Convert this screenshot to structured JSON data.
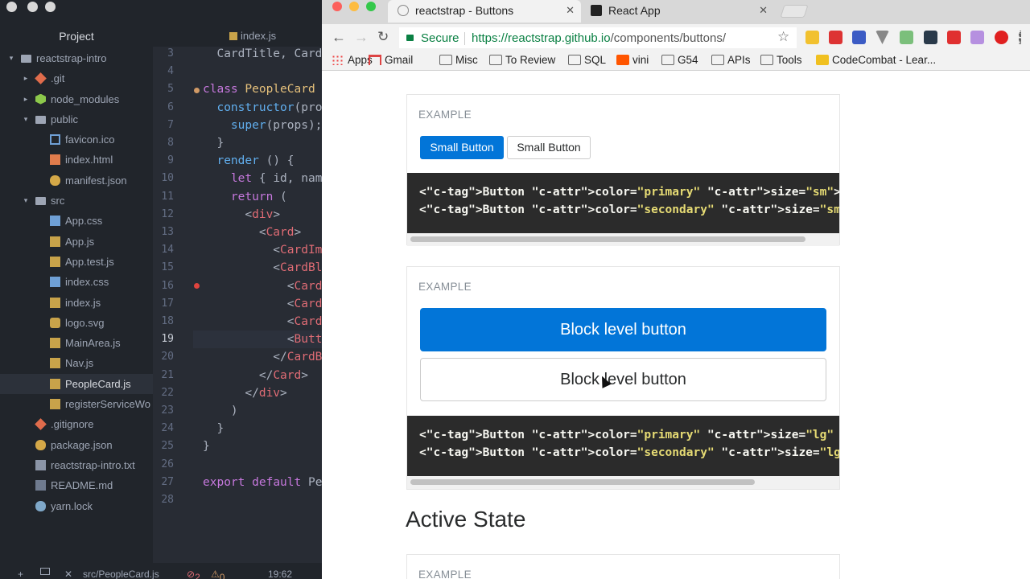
{
  "atom": {
    "tree_header": "Project",
    "tab_title": "index.js",
    "tree": [
      {
        "label": "reactstrap-intro",
        "icon": "folder-icon",
        "indent": 0,
        "arrow": "▾"
      },
      {
        "label": ".git",
        "icon": "git-icon",
        "indent": 1,
        "arrow": "▸"
      },
      {
        "label": "node_modules",
        "icon": "node-icon",
        "indent": 1,
        "arrow": "▸"
      },
      {
        "label": "public",
        "icon": "folder-icon",
        "indent": 1,
        "arrow": "▾"
      },
      {
        "label": "favicon.ico",
        "icon": "image-icon",
        "indent": 2
      },
      {
        "label": "index.html",
        "icon": "html-icon",
        "indent": 2
      },
      {
        "label": "manifest.json",
        "icon": "json-icon",
        "indent": 2
      },
      {
        "label": "src",
        "icon": "folder-icon",
        "indent": 1,
        "arrow": "▾"
      },
      {
        "label": "App.css",
        "icon": "css-icon",
        "indent": 2
      },
      {
        "label": "App.js",
        "icon": "js-icon",
        "indent": 2
      },
      {
        "label": "App.test.js",
        "icon": "js-icon",
        "indent": 2
      },
      {
        "label": "index.css",
        "icon": "css-icon",
        "indent": 2
      },
      {
        "label": "index.js",
        "icon": "js-icon",
        "indent": 2
      },
      {
        "label": "logo.svg",
        "icon": "svg-icon",
        "indent": 2
      },
      {
        "label": "MainArea.js",
        "icon": "js-icon",
        "indent": 2
      },
      {
        "label": "Nav.js",
        "icon": "js-icon",
        "indent": 2
      },
      {
        "label": "PeopleCard.js",
        "icon": "js-icon",
        "indent": 2,
        "selected": true
      },
      {
        "label": "registerServiceWo",
        "icon": "js-icon",
        "indent": 2
      },
      {
        "label": ".gitignore",
        "icon": "git-icon",
        "indent": 1
      },
      {
        "label": "package.json",
        "icon": "json-icon",
        "indent": 1
      },
      {
        "label": "reactstrap-intro.txt",
        "icon": "txt-icon",
        "indent": 1
      },
      {
        "label": "README.md",
        "icon": "md-icon",
        "indent": 1
      },
      {
        "label": "yarn.lock",
        "icon": "yarn-icon",
        "indent": 1
      }
    ],
    "line_numbers": [
      "3",
      "4",
      "5",
      "6",
      "7",
      "8",
      "9",
      "10",
      "11",
      "12",
      "13",
      "14",
      "15",
      "16",
      "17",
      "18",
      "19",
      "20",
      "21",
      "22",
      "23",
      "24",
      "25",
      "26",
      "27",
      "28"
    ],
    "current_line": "19",
    "code_lines": [
      "  CardTitle, Card",
      "",
      "class PeopleCard ",
      "  constructor(pro",
      "    super(props);",
      "  }",
      "  render () {",
      "    let { id, nam",
      "    return (",
      "      <div>",
      "        <Card>",
      "          <CardIm",
      "          <CardBl",
      "            <Card",
      "            <Card",
      "            <Card",
      "            <Butt",
      "          </CardB",
      "        </Card>",
      "      </div>",
      "    )",
      "  }",
      "}",
      "",
      "export default Pe",
      ""
    ],
    "status": {
      "file": "src/PeopleCard.js",
      "errors": "2",
      "warnings": "0",
      "position": "19:62"
    }
  },
  "browser": {
    "tabs": [
      {
        "title": "reactstrap - Buttons",
        "active": true
      },
      {
        "title": "React App",
        "active": false
      }
    ],
    "secure_label": "Secure",
    "url_host": "https://reactstrap.github.io",
    "url_path": "/components/buttons/",
    "bookmarks": [
      {
        "label": "Apps",
        "icon": "apps-icon"
      },
      {
        "label": "Gmail",
        "icon": "gmail-icon"
      },
      {
        "label": "Misc",
        "icon": "folder-icon"
      },
      {
        "label": "To Review",
        "icon": "folder-icon"
      },
      {
        "label": "SQL",
        "icon": "folder-icon"
      },
      {
        "label": "vini",
        "icon": "soundcloud-icon"
      },
      {
        "label": "G54",
        "icon": "folder-icon"
      },
      {
        "label": "APIs",
        "icon": "folder-icon"
      },
      {
        "label": "Tools",
        "icon": "folder-icon"
      },
      {
        "label": "CodeCombat - Lear...",
        "icon": "codecombat-icon"
      }
    ]
  },
  "page": {
    "example_label": "EXAMPLE",
    "small_primary": "Small Button",
    "small_secondary": "Small Button",
    "small_code": [
      "<Button color=\"primary\" size=\"sm\">Small Button</Button>{'",
      "<Button color=\"secondary\" size=\"sm\">Small Button</Button>"
    ],
    "block_primary": "Block level button",
    "block_secondary": "Block level button",
    "block_code": [
      "<Button color=\"primary\" size=\"lg\" block>Block level butto",
      "<Button color=\"secondary\" size=\"lg\" block>Block level but"
    ],
    "section_heading": "Active State"
  },
  "colors": {
    "primary": "#0275d8",
    "secure_green": "#0a8043"
  }
}
